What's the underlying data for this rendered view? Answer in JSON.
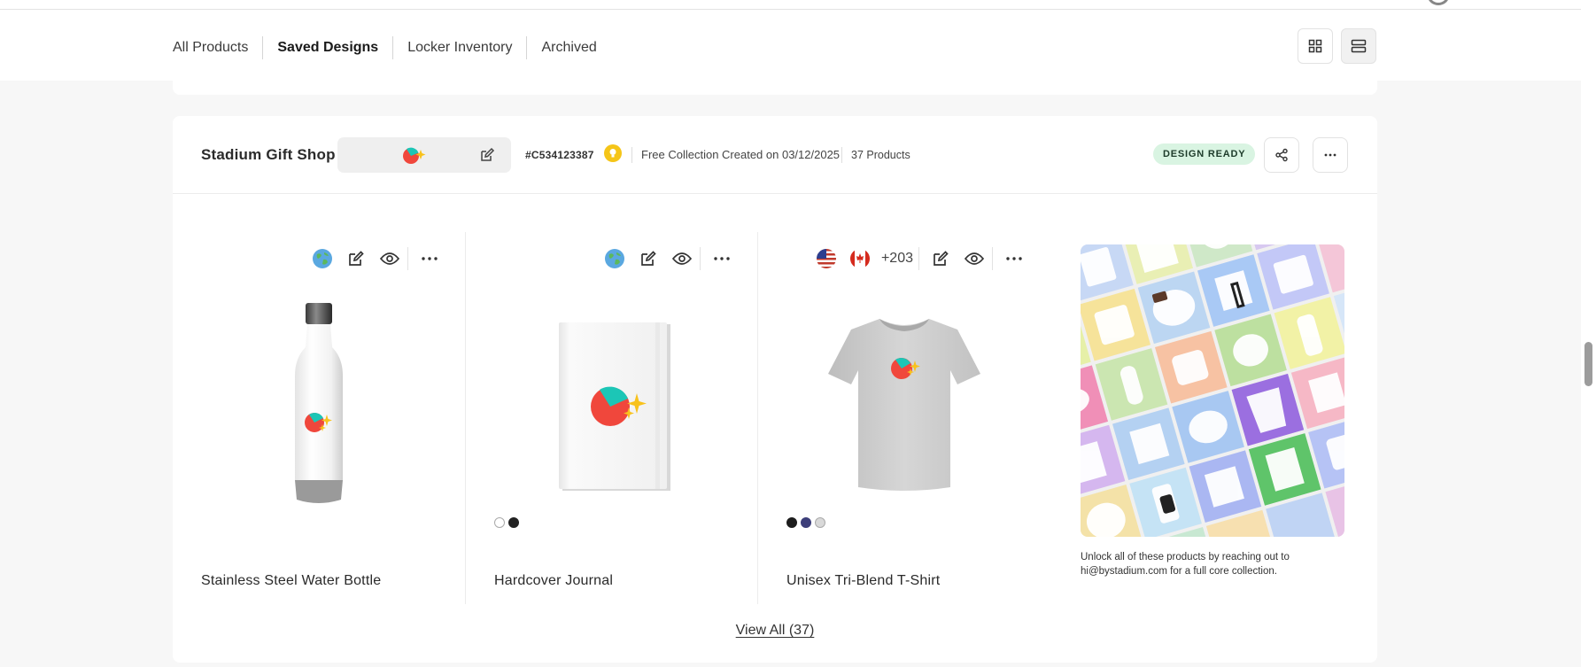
{
  "tabs": [
    {
      "label": "All Products"
    },
    {
      "label": "Saved Designs"
    },
    {
      "label": "Locker Inventory"
    },
    {
      "label": "Archived"
    }
  ],
  "collection": {
    "name": "Stadium Gift Shop",
    "id": "#C534123387",
    "created": "Free Collection Created on 03/12/2025",
    "product_count": "37 Products",
    "status": "DESIGN READY"
  },
  "products": [
    {
      "name": "Stainless Steel Water Bottle"
    },
    {
      "name": "Hardcover Journal"
    },
    {
      "name": "Unisex Tri-Blend T-Shirt",
      "extra_regions": "+203"
    }
  ],
  "promo": {
    "text": "Unlock all of these products by reaching out to hi@bystadium.com for a full core collection."
  },
  "view_all": "View All (37)",
  "colors": {
    "badge_bg": "#d9f4e2",
    "logo_teal": "#1cc6b6",
    "logo_red": "#f0473c",
    "logo_yellow": "#f8c21c"
  }
}
